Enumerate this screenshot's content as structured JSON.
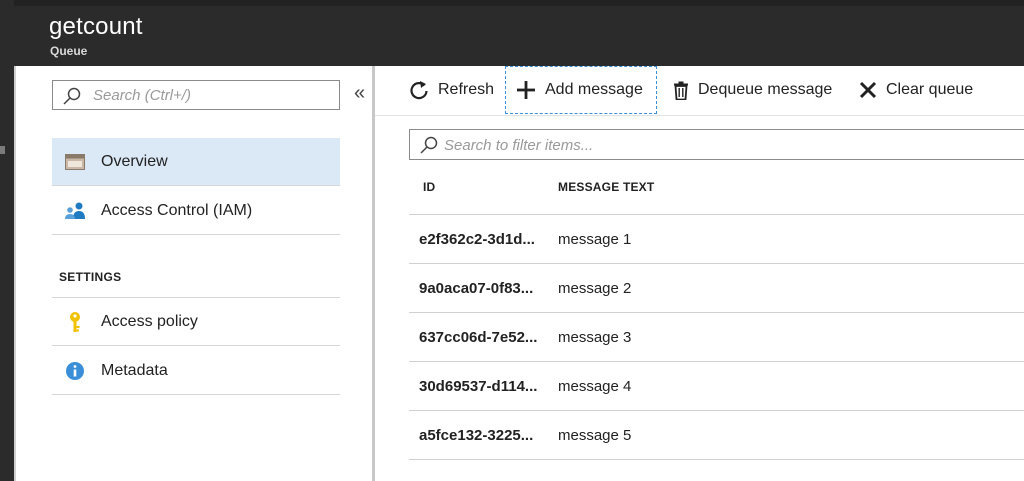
{
  "header": {
    "title": "getcount",
    "subtitle": "Queue"
  },
  "sidebar": {
    "search_placeholder": "Search (Ctrl+/)",
    "collapse_glyph": "«",
    "items": [
      {
        "label": "Overview",
        "icon": "overview-icon"
      },
      {
        "label": "Access Control (IAM)",
        "icon": "users-icon"
      }
    ],
    "settings_title": "SETTINGS",
    "settings_items": [
      {
        "label": "Access policy",
        "icon": "key-icon"
      },
      {
        "label": "Metadata",
        "icon": "info-icon"
      }
    ]
  },
  "toolbar": {
    "refresh": "Refresh",
    "add_message": "Add message",
    "dequeue_message": "Dequeue message",
    "clear_queue": "Clear queue"
  },
  "filter": {
    "placeholder": "Search to filter items..."
  },
  "table": {
    "columns": [
      "ID",
      "MESSAGE TEXT"
    ],
    "rows": [
      {
        "id": "e2f362c2-3d1d...",
        "text": "message 1"
      },
      {
        "id": "9a0aca07-0f83...",
        "text": "message 2"
      },
      {
        "id": "637cc06d-7e52...",
        "text": "message 3"
      },
      {
        "id": "30d69537-d114...",
        "text": "message 4"
      },
      {
        "id": "a5fce132-3225...",
        "text": "message 5"
      }
    ]
  },
  "colors": {
    "header_bg": "#2b2b2b",
    "active_nav_bg": "#dbe8f5",
    "accent_blue": "#1f7bc1",
    "key_yellow": "#f2c200"
  }
}
